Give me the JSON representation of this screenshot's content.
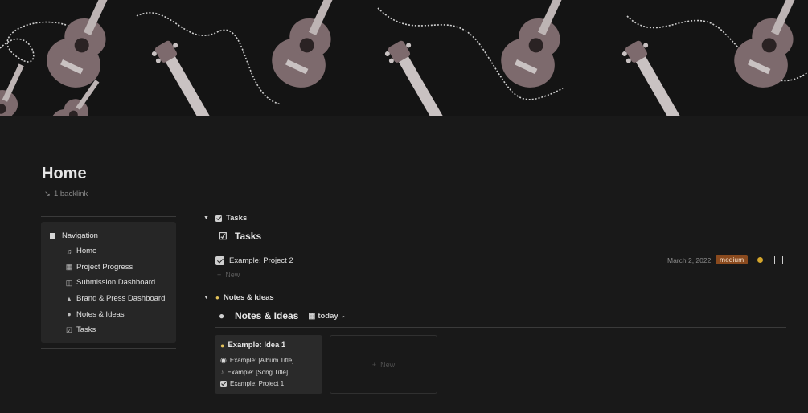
{
  "page": {
    "title": "Home",
    "backlink": "1 backlink"
  },
  "navigation": {
    "heading": "Navigation",
    "items": [
      {
        "label": "Home",
        "icon": "guitar-icon"
      },
      {
        "label": "Project Progress",
        "icon": "chart-icon"
      },
      {
        "label": "Submission Dashboard",
        "icon": "inbox-icon"
      },
      {
        "label": "Brand & Press Dashboard",
        "icon": "megaphone-icon"
      },
      {
        "label": "Notes & Ideas",
        "icon": "lightbulb-icon"
      },
      {
        "label": "Tasks",
        "icon": "checkbox-icon"
      }
    ]
  },
  "tasks_section": {
    "toggle_label": "Tasks",
    "db_title": "Tasks",
    "rows": [
      {
        "name": "Example: Project 2",
        "date": "March 2, 2022",
        "priority": "medium",
        "done": true
      }
    ],
    "new_label": "New"
  },
  "notes_section": {
    "toggle_label": "Notes & Ideas",
    "db_title": "Notes & Ideas",
    "view_label": "today",
    "cards": [
      {
        "title": "Example: Idea 1",
        "relations": [
          "Example: [Album Title]",
          "Example: [Song Title]",
          "Example: Project 1"
        ]
      }
    ],
    "new_label": "New"
  },
  "colors": {
    "background": "#191919",
    "priority_medium": "#8a4a1e",
    "status_dot": "#d4a52b"
  }
}
